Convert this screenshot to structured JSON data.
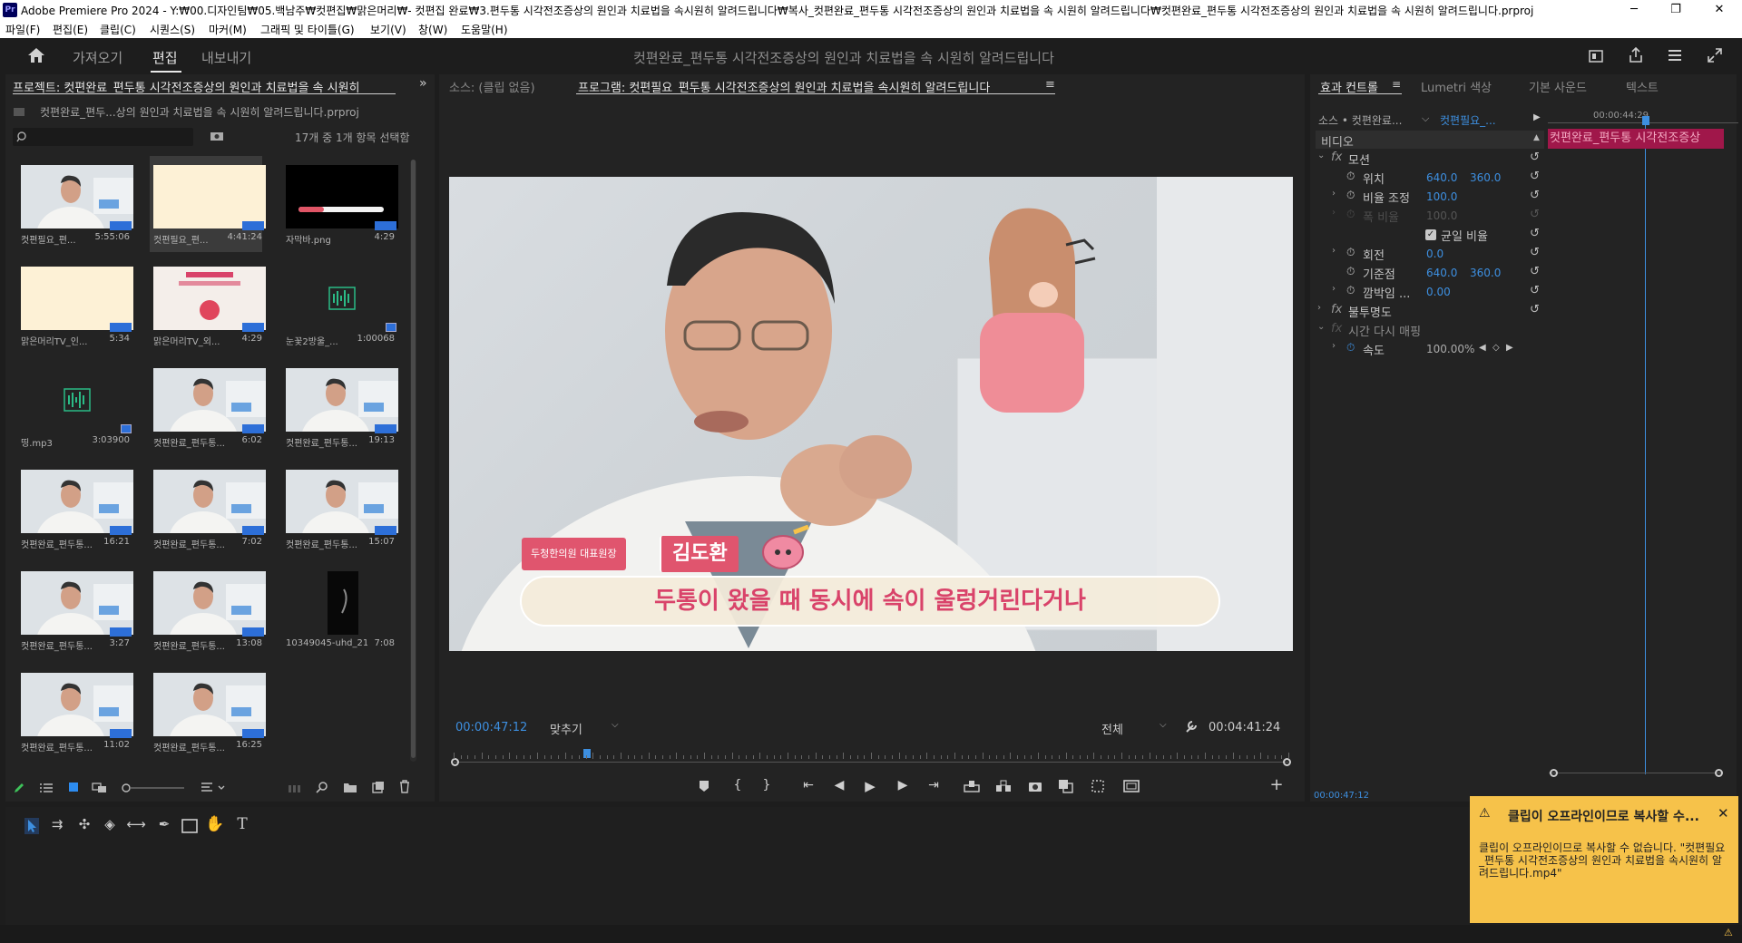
{
  "window": {
    "title": "Adobe Premiere Pro 2024 - Y:₩00.디자인팀₩05.백남주₩컷편집₩맑은머리₩- 컷편집 완료₩3.편두통 시각전조증상의 원인과 치료법을 속시원히 알려드립니다₩복사_컷편완료_편두통 시각전조증상의 원인과 치료법을 속 시원히 알려드립니다₩컷편완료_편두통 시각전조증상의 원인과 치료법을 속 시원히 알려드립니다.prproj",
    "minimize": "─",
    "maximize": "❐",
    "close": "✕"
  },
  "menu": [
    "파일(F)",
    "편집(E)",
    "클립(C)",
    "시퀀스(S)",
    "마커(M)",
    "그래픽 및 타이틀(G)",
    "보기(V)",
    "창(W)",
    "도움말(H)"
  ],
  "workspace": {
    "tabs": [
      "가져오기",
      "편집",
      "내보내기"
    ],
    "active": "편집",
    "project_title": "컷편완료_편두통 시각전조증상의 원인과 치료법을 속 시원히 알려드립니다"
  },
  "project_panel": {
    "tab_label": "프로젝트: 컷편완료_편두통 시각전조증상의 원인과 치료법을 속 시원히",
    "file_name": "컷편완료_편두...상의 원인과 치료법을 속 시원히 알려드립니다.prproj",
    "search_placeholder": "",
    "selection_count": "17개 중 1개 항목 선택함",
    "items": [
      {
        "name": "컷편필요_편...",
        "duration": "5:55:06",
        "kind": "video"
      },
      {
        "name": "컷편필요_편...",
        "duration": "4:41:24",
        "kind": "cream",
        "selected": true
      },
      {
        "name": "자막바.png",
        "duration": "4:29",
        "kind": "black"
      },
      {
        "name": "맑은머리TV_인...",
        "duration": "5:34",
        "kind": "cream"
      },
      {
        "name": "맑은머리TV_외...",
        "duration": "4:29",
        "kind": "banner"
      },
      {
        "name": "눈꽃2방울_...",
        "duration": "1:00068",
        "kind": "audio"
      },
      {
        "name": "띵.mp3",
        "duration": "3:03900",
        "kind": "audio"
      },
      {
        "name": "컷편완료_편두통...",
        "duration": "6:02",
        "kind": "video"
      },
      {
        "name": "컷편완료_편두통...",
        "duration": "19:13",
        "kind": "video"
      },
      {
        "name": "컷편완료_편두통...",
        "duration": "16:21",
        "kind": "video"
      },
      {
        "name": "컷편완료_편두통...",
        "duration": "7:02",
        "kind": "video"
      },
      {
        "name": "컷편완료_편두통...",
        "duration": "15:07",
        "kind": "video"
      },
      {
        "name": "컷편완료_편두통...",
        "duration": "3:27",
        "kind": "video"
      },
      {
        "name": "컷편완료_편두통...",
        "duration": "13:08",
        "kind": "video"
      },
      {
        "name": "10349045-uhd_21...",
        "duration": "7:08",
        "kind": "dark"
      },
      {
        "name": "컷편완료_편두통...",
        "duration": "11:02",
        "kind": "video"
      },
      {
        "name": "컷편완료_편두통...",
        "duration": "16:25",
        "kind": "video"
      }
    ]
  },
  "source_tab": "소스: (클립 없음)",
  "program_tab": "프로그램: 컷편필요_편두통 시각전조증상의 원인과 치료법을 속시원히 알려드립니다",
  "program": {
    "name_badge_org": "두청한의원 대표원장",
    "name_badge_name": "김도환",
    "subtitle": "두통이 왔을 때 동시에 속이 울렁거린다거나",
    "timecode": "00:00:47:12",
    "fit": "맞추기",
    "resolution": "전체",
    "duration": "00:04:41:24",
    "playhead_fraction": 0.16
  },
  "effect_controls": {
    "tabs": [
      "효과 컨트롤",
      "Lumetri 색상",
      "기본 사운드",
      "텍스트"
    ],
    "source_label": "소스 • 컷편완료...",
    "clip_label": "컷편필요_...",
    "timeline_time": "00:00:44:29",
    "clip_bar": "컷편완료_편두통 시각전조증상",
    "video_label": "비디오",
    "motion": "모션",
    "position_label": "위치",
    "position_x": "640.0",
    "position_y": "360.0",
    "scale_label": "비율 조정",
    "scale": "100.0",
    "width_label": "폭 비율",
    "width": "100.0",
    "uniform_label": "균일 비율",
    "rotation_label": "회전",
    "rotation": "0.0",
    "anchor_label": "기준점",
    "anchor_x": "640.0",
    "anchor_y": "360.0",
    "flicker_label": "깜박임 ...",
    "flicker": "0.00",
    "opacity": "불투명도",
    "time_remap": "시간 다시 매핑",
    "speed_label": "속도",
    "speed": "100.00%",
    "footer_time": "00:00:47:12"
  },
  "notification": {
    "title": "클립이 오프라인이므로 복사할 수...",
    "body": "클립이 오프라인이므로 복사할 수 없습니다. \"컷편필요_편두통 시각전조증상의 원인과 치료법을 속시원히 알려드립니다.mp4\""
  },
  "colors": {
    "accent_blue": "#3d8fe0",
    "clip_pink": "#c2185b",
    "subtitle_pink": "#d9436a",
    "notification": "#f6c24a"
  }
}
